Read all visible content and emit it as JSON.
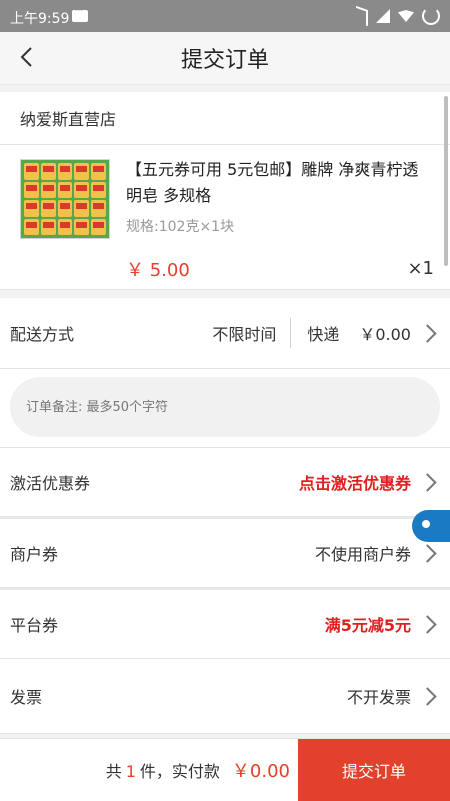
{
  "statusbar": {
    "time": "上午9:59"
  },
  "header": {
    "title": "提交订单"
  },
  "store": {
    "name": "纳爱斯直营店"
  },
  "item": {
    "title": "【五元券可用 5元包邮】雕牌 净爽青柠透明皂 多规格",
    "spec": "规格:102克×1块",
    "price": "￥ 5.00",
    "qty": "×1"
  },
  "delivery": {
    "label": "配送方式",
    "time": "不限时间",
    "method": "快递",
    "fee": "￥0.00"
  },
  "note": {
    "placeholder": "订单备注: 最多50个字符"
  },
  "coupon_activate": {
    "label": "激活优惠券",
    "value": "点击激活优惠券"
  },
  "merchant_coupon": {
    "label": "商户券",
    "value": "不使用商户券"
  },
  "platform_coupon": {
    "label": "平台券",
    "value": "满5元减5元"
  },
  "invoice": {
    "label": "发票",
    "value": "不开发票"
  },
  "footer": {
    "prefix": "共",
    "count": "1",
    "suffix": "件，实付款",
    "amount": "￥0.00",
    "submit": "提交订单"
  },
  "colors": {
    "accent": "#e2412c",
    "status_bar": "#8a8a8a"
  },
  "icons": [
    "message-icon",
    "bluetooth-icon",
    "signal-icon",
    "wifi-icon",
    "loading-icon",
    "back-arrow-icon",
    "chevron-right-icon"
  ]
}
